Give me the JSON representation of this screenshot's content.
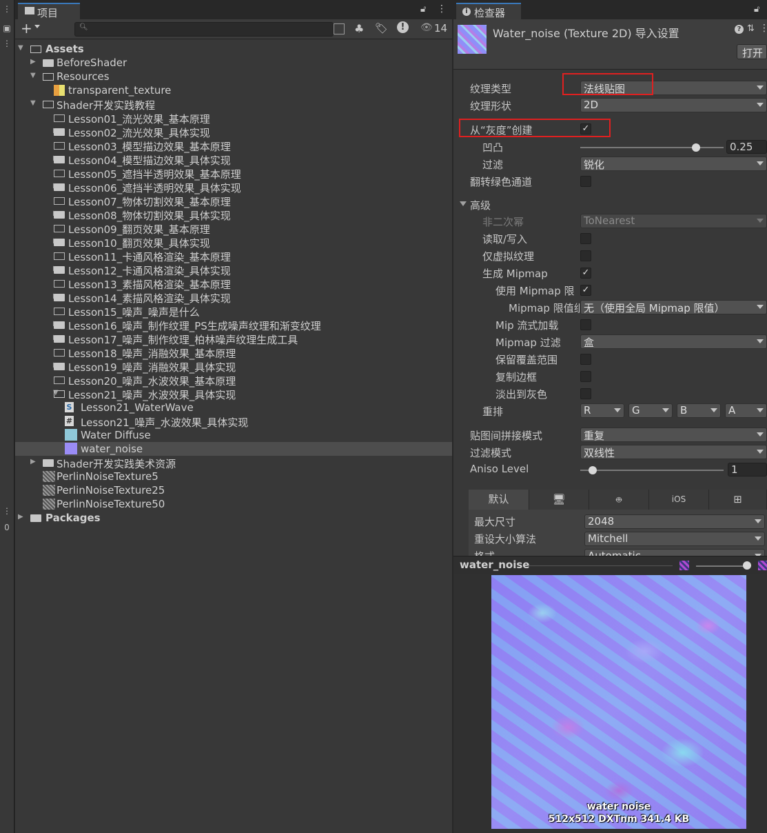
{
  "project": {
    "tab_label": "项目",
    "add_label": "+",
    "search_placeholder": "",
    "hidden_count": "14"
  },
  "tree": [
    {
      "label": "Assets",
      "depth": 0,
      "arrow": "down",
      "icon": "folder-open",
      "bold": true
    },
    {
      "label": "BeforeShader",
      "depth": 1,
      "arrow": "right",
      "icon": "folder"
    },
    {
      "label": "Resources",
      "depth": 1,
      "arrow": "down",
      "icon": "folder-open"
    },
    {
      "label": "transparent_texture",
      "depth": 2,
      "arrow": "",
      "icon": "texture-transparent"
    },
    {
      "label": "Shader开发实践教程",
      "depth": 1,
      "arrow": "down",
      "icon": "folder-open"
    },
    {
      "label": "Lesson01_流光效果_基本原理",
      "depth": 2,
      "arrow": "",
      "icon": "folder-empty"
    },
    {
      "label": "Lesson02_流光效果_具体实现",
      "depth": 2,
      "arrow": "right",
      "icon": "folder"
    },
    {
      "label": "Lesson03_模型描边效果_基本原理",
      "depth": 2,
      "arrow": "",
      "icon": "folder-empty"
    },
    {
      "label": "Lesson04_模型描边效果_具体实现",
      "depth": 2,
      "arrow": "right",
      "icon": "folder"
    },
    {
      "label": "Lesson05_遮挡半透明效果_基本原理",
      "depth": 2,
      "arrow": "",
      "icon": "folder-empty"
    },
    {
      "label": "Lesson06_遮挡半透明效果_具体实现",
      "depth": 2,
      "arrow": "right",
      "icon": "folder"
    },
    {
      "label": "Lesson07_物体切割效果_基本原理",
      "depth": 2,
      "arrow": "",
      "icon": "folder-empty"
    },
    {
      "label": "Lesson08_物体切割效果_具体实现",
      "depth": 2,
      "arrow": "right",
      "icon": "folder"
    },
    {
      "label": "Lesson09_翻页效果_基本原理",
      "depth": 2,
      "arrow": "",
      "icon": "folder-empty"
    },
    {
      "label": "Lesson10_翻页效果_具体实现",
      "depth": 2,
      "arrow": "right",
      "icon": "folder"
    },
    {
      "label": "Lesson11_卡通风格渲染_基本原理",
      "depth": 2,
      "arrow": "",
      "icon": "folder-empty"
    },
    {
      "label": "Lesson12_卡通风格渲染_具体实现",
      "depth": 2,
      "arrow": "right",
      "icon": "folder"
    },
    {
      "label": "Lesson13_素描风格渲染_基本原理",
      "depth": 2,
      "arrow": "",
      "icon": "folder-empty"
    },
    {
      "label": "Lesson14_素描风格渲染_具体实现",
      "depth": 2,
      "arrow": "right",
      "icon": "folder"
    },
    {
      "label": "Lesson15_噪声_噪声是什么",
      "depth": 2,
      "arrow": "",
      "icon": "folder-empty"
    },
    {
      "label": "Lesson16_噪声_制作纹理_PS生成噪声纹理和渐变纹理",
      "depth": 2,
      "arrow": "right",
      "icon": "folder"
    },
    {
      "label": "Lesson17_噪声_制作纹理_柏林噪声纹理生成工具",
      "depth": 2,
      "arrow": "right",
      "icon": "folder"
    },
    {
      "label": "Lesson18_噪声_消融效果_基本原理",
      "depth": 2,
      "arrow": "",
      "icon": "folder-empty"
    },
    {
      "label": "Lesson19_噪声_消融效果_具体实现",
      "depth": 2,
      "arrow": "right",
      "icon": "folder"
    },
    {
      "label": "Lesson20_噪声_水波效果_基本原理",
      "depth": 2,
      "arrow": "",
      "icon": "folder-empty"
    },
    {
      "label": "Lesson21_噪声_水波效果_具体实现",
      "depth": 2,
      "arrow": "down",
      "icon": "folder-open"
    },
    {
      "label": "Lesson21_WaterWave",
      "depth": 3,
      "arrow": "",
      "icon": "shader"
    },
    {
      "label": "Lesson21_噪声_水波效果_具体实现",
      "depth": 3,
      "arrow": "",
      "icon": "script"
    },
    {
      "label": "Water Diffuse",
      "depth": 3,
      "arrow": "",
      "icon": "texture-diffuse"
    },
    {
      "label": "water_noise",
      "depth": 3,
      "arrow": "",
      "icon": "texture-normal",
      "selected": true
    },
    {
      "label": "Shader开发实践美术资源",
      "depth": 1,
      "arrow": "right",
      "icon": "folder"
    },
    {
      "label": "PerlinNoiseTexture5",
      "depth": 1,
      "arrow": "",
      "icon": "texture-perlin"
    },
    {
      "label": "PerlinNoiseTexture25",
      "depth": 1,
      "arrow": "",
      "icon": "texture-perlin"
    },
    {
      "label": "PerlinNoiseTexture50",
      "depth": 1,
      "arrow": "",
      "icon": "texture-perlin"
    },
    {
      "label": "Packages",
      "depth": 0,
      "arrow": "right",
      "icon": "folder",
      "bold": true
    }
  ],
  "inspector": {
    "tab_label": "检查器",
    "title": "Water_noise (Texture 2D) 导入设置",
    "open_button": "打开",
    "texture_type_label": "纹理类型",
    "texture_type_value": "法线贴图",
    "texture_shape_label": "纹理形状",
    "texture_shape_value": "2D",
    "from_grayscale_label": "从“灰度”创建",
    "bumpiness_label": "凹凸",
    "bumpiness_value": "0.25",
    "filtering_label": "过滤",
    "filtering_value": "锐化",
    "flip_green_label": "翻转绿色通道",
    "advanced_label": "高级",
    "npot_label": "非二次幂",
    "npot_value": "ToNearest",
    "readwrite_label": "读取/写入",
    "virtual_label": "仅虚拟纹理",
    "gen_mipmap_label": "生成 Mipmap",
    "use_mipmap_limit_label": "使用 Mipmap 限",
    "mipmap_limit_label": "Mipmap 限值组",
    "mipmap_limit_value": "无（使用全局 Mipmap 限值）",
    "mip_stream_label": "Mip 流式加载",
    "mipmap_filter_label": "Mipmap 过滤",
    "mipmap_filter_value": "盒",
    "preserve_coverage_label": "保留覆盖范围",
    "replicate_border_label": "复制边框",
    "fadeout_label": "淡出到灰色",
    "swizzle_label": "重排",
    "swizzle_r": "R",
    "swizzle_g": "G",
    "swizzle_b": "B",
    "swizzle_a": "A",
    "wrap_label": "贴图间拼接模式",
    "wrap_value": "重复",
    "filter_mode_label": "过滤模式",
    "filter_mode_value": "双线性",
    "aniso_label": "Aniso Level",
    "aniso_value": "1",
    "platform_default": "默认",
    "platform_ios": "iOS",
    "max_size_label": "最大尺寸",
    "max_size_value": "2048",
    "resize_label": "重设大小算法",
    "resize_value": "Mitchell",
    "format_label": "格式",
    "format_value": "Automatic",
    "preview_name": "water_noise",
    "preview_caption_name": "water noise",
    "preview_caption_info": "512x512  DXTnm    341.4 KB"
  },
  "colors": {
    "accent_tab": "#3a79bb",
    "highlight_red": "#e02020",
    "selected_row": "#4d4d4d"
  }
}
